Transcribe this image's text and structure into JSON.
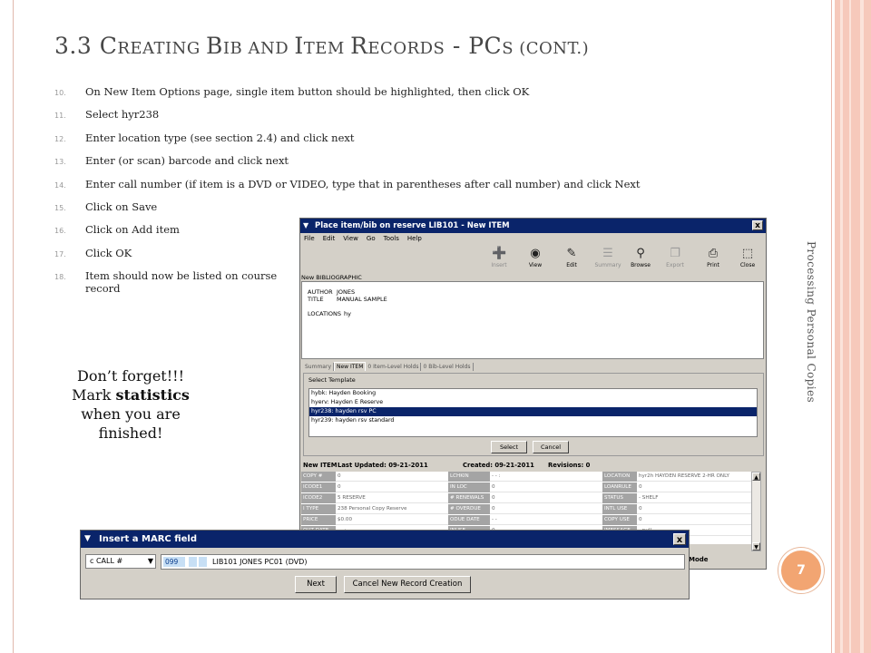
{
  "slide": {
    "title_parts": [
      {
        "text": "3.3 C",
        "size": "big"
      },
      {
        "text": "REATING ",
        "size": "small"
      },
      {
        "text": "B",
        "size": "big"
      },
      {
        "text": "IB AND ",
        "size": "small"
      },
      {
        "text": "I",
        "size": "big"
      },
      {
        "text": "TEM ",
        "size": "small"
      },
      {
        "text": "R",
        "size": "big"
      },
      {
        "text": "ECORDS - PC",
        "size": "small"
      },
      {
        "text": "S (",
        "size": "small"
      },
      {
        "text": "CONT",
        "size": "small"
      },
      {
        "text": ".)",
        "size": "small"
      }
    ],
    "title_display": [
      "3.3 C",
      "REATING ",
      "B",
      "IB AND ",
      "I",
      "TEM ",
      "R",
      "ECORDS",
      " - PC",
      "S",
      " (",
      "CONT",
      ".)"
    ],
    "steps": [
      {
        "num": "10.",
        "text": "On New Item Options page, single item button should be highlighted, then click OK"
      },
      {
        "num": "11.",
        "text": "Select hyr238"
      },
      {
        "num": "12.",
        "text": "Enter location type (see section 2.4) and click next"
      },
      {
        "num": "13.",
        "text": "Enter (or scan) barcode and click next"
      },
      {
        "num": "14.",
        "text": "Enter call number (if item is a DVD or VIDEO, type that in parentheses after call number) and click Next"
      },
      {
        "num": "15.",
        "text": "Click on Save"
      },
      {
        "num": "16.",
        "text": "Click on Add item"
      },
      {
        "num": "17.",
        "text": "Click OK"
      },
      {
        "num": "18.",
        "text": "Item should now be listed on course record"
      }
    ],
    "reminder": {
      "line1": "Don’t forget!!!",
      "line2a": "Mark ",
      "line2b": "statistics",
      "line3": "when you are",
      "line4": "finished!"
    },
    "side_text": "Processing Personal Copies",
    "page_number": "7",
    "colors": {
      "badge": "#f2a572",
      "band": "#f6c9bb",
      "titlebar": "#0a246a"
    }
  },
  "window_main": {
    "title": "Place item/bib on reserve LIB101 - New ITEM",
    "close": "x",
    "menu": [
      "File",
      "Edit",
      "View",
      "Go",
      "Tools",
      "Help"
    ],
    "toolbar": [
      {
        "label": "Insert",
        "icon": "insert-icon",
        "glyph": "➕",
        "enabled": false
      },
      {
        "label": "View",
        "icon": "view-icon",
        "glyph": "◉",
        "enabled": true
      },
      {
        "label": "Edit",
        "icon": "edit-icon",
        "glyph": "✎",
        "enabled": true
      },
      {
        "label": "Summary",
        "icon": "summary-icon",
        "glyph": "☰",
        "enabled": false
      },
      {
        "label": "Browse",
        "icon": "browse-icon",
        "glyph": "⚲",
        "enabled": true
      },
      {
        "label": "Export",
        "icon": "export-icon",
        "glyph": "❐",
        "enabled": false
      },
      {
        "label": "Print",
        "icon": "print-icon",
        "glyph": "⎙",
        "enabled": true
      },
      {
        "label": "Close",
        "icon": "close-folder-icon",
        "glyph": "⬚",
        "enabled": true
      }
    ],
    "bib_label": "New BIBLIOGRAPHIC",
    "bib": {
      "author_k": "AUTHOR",
      "author_v": "JONES",
      "title_k": "TITLE",
      "title_v": "MANUAL SAMPLE",
      "loc_k": "LOCATIONS",
      "loc_v": "hy"
    },
    "tabs": [
      "Summary",
      "New ITEM",
      "0 Item-Level Holds",
      "0 Bib-Level Holds"
    ],
    "active_tab": 1,
    "template_label": "Select Template",
    "templates": [
      "hybk:  Hayden Booking",
      "hyerv:  Hayden E Reserve",
      "hyr238:  hayden rsv PC",
      "hyr239:  hayden rsv standard"
    ],
    "selected_template": 2,
    "select_btn": "Select",
    "cancel_btn": "Cancel",
    "item_header": {
      "name": "New ITEM",
      "updated": "Last Updated: 09-21-2011",
      "created": "Created: 09-21-2011",
      "revisions": "Revisions: 0"
    },
    "grid_rows": [
      [
        "COPY #",
        "0",
        "LCHKIN",
        "- -   :",
        "LOCATION",
        "hyr2h   HAYDEN RESERVE 2-HR ONLY"
      ],
      [
        "ICODE1",
        "0",
        "IN LOC",
        "0",
        "LOANRULE",
        "0"
      ],
      [
        "ICODE2",
        "5   RESERVE",
        "# RENEWALS",
        "0",
        "STATUS",
        "-   SHELF"
      ],
      [
        "I TYPE",
        "238   Personal Copy Reserve",
        "# OVERDUE",
        "0",
        "INTL USE",
        "0"
      ],
      [
        "PRICE",
        "$0.00",
        "ODUE DATE",
        "- -",
        "COPY USE",
        "0"
      ],
      [
        "OUT DATE",
        "- -   :",
        "INUSE",
        "0",
        "IMESSAGE",
        "-   null"
      ]
    ],
    "mode": "Mode"
  },
  "window_marc": {
    "title": "Insert a MARC field",
    "close": "x",
    "field_type": "c  CALL #",
    "tag": "099",
    "value": "LIB101 JONES PC01 (DVD)",
    "next_btn": "Next",
    "cancel_btn": "Cancel New Record Creation"
  }
}
